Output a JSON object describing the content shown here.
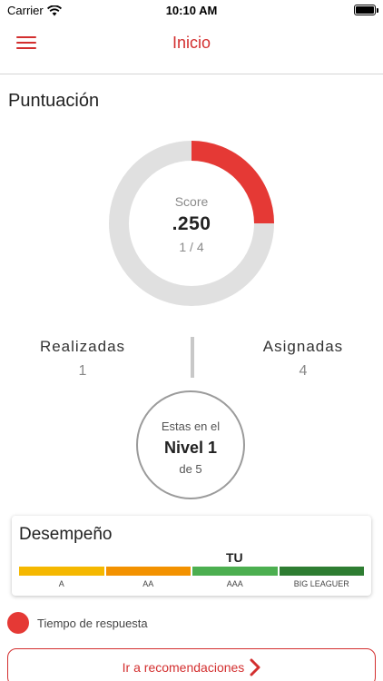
{
  "status_bar": {
    "carrier": "Carrier",
    "time": "10:10 AM"
  },
  "header": {
    "title": "Inicio",
    "menu_icon": "hamburger-menu-icon"
  },
  "score_section": {
    "title": "Puntuación",
    "score_label": "Score",
    "score_value": ".250",
    "score_fraction": "1 / 4",
    "progress": 0.25,
    "colors": {
      "progress": "#e53935",
      "track": "#e0e0e0"
    }
  },
  "stats": {
    "completed": {
      "label": "Realizadas",
      "value": "1"
    },
    "assigned": {
      "label": "Asignadas",
      "value": "4"
    }
  },
  "level": {
    "line1": "Estas en el",
    "line2": "Nivel 1",
    "line3": "de 5"
  },
  "performance": {
    "title": "Desempeño",
    "you_label": "TU",
    "tiers": [
      {
        "label": "A",
        "color": "#f5b800"
      },
      {
        "label": "AA",
        "color": "#f39200"
      },
      {
        "label": "AAA",
        "color": "#4caf50"
      },
      {
        "label": "BIG LEAGUER",
        "color": "#2e7d32"
      }
    ]
  },
  "legend": {
    "label": "Tiempo de respuesta",
    "color": "#e53935"
  },
  "recommendations_button": {
    "label": "Ir a recomendaciones"
  }
}
